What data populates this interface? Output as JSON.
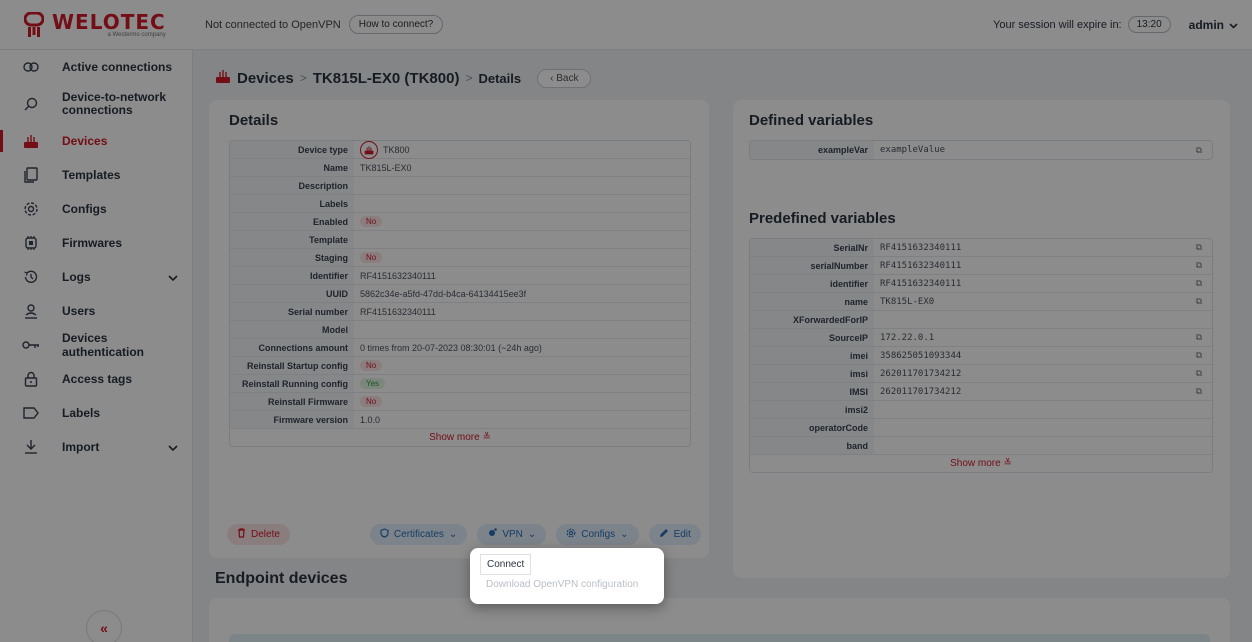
{
  "header": {
    "logo_word": "WELOTEC",
    "logo_sub": "a Westermo company",
    "connection_status": "Not connected to OpenVPN",
    "how_to_connect": "How to connect?",
    "session_label": "Your session will expire in:",
    "session_time": "13:20",
    "user": "admin"
  },
  "sidebar": {
    "items": [
      {
        "label": "Active connections",
        "icon": "link-icon"
      },
      {
        "label": "Device-to-network connections",
        "icon": "search-network-icon"
      },
      {
        "label": "Devices",
        "icon": "router-icon"
      },
      {
        "label": "Templates",
        "icon": "copy-icon"
      },
      {
        "label": "Configs",
        "icon": "gear-icon"
      },
      {
        "label": "Firmwares",
        "icon": "chip-icon"
      },
      {
        "label": "Logs",
        "icon": "history-icon"
      },
      {
        "label": "Users",
        "icon": "user-icon"
      },
      {
        "label": "Devices authentication",
        "icon": "key-icon"
      },
      {
        "label": "Access tags",
        "icon": "lock-icon"
      },
      {
        "label": "Labels",
        "icon": "tag-icon"
      },
      {
        "label": "Import",
        "icon": "import-icon"
      }
    ],
    "collapse_glyph": "«"
  },
  "breadcrumb": {
    "devices": "Devices",
    "device": "TK815L-EX0 (TK800)",
    "details": "Details",
    "back": "Back",
    "sep": ">"
  },
  "details": {
    "title": "Details",
    "rows": [
      {
        "key": "Device type",
        "value": "TK800"
      },
      {
        "key": "Name",
        "value": "TK815L-EX0"
      },
      {
        "key": "Description",
        "value": ""
      },
      {
        "key": "Labels",
        "value": ""
      },
      {
        "key": "Enabled",
        "value": "No"
      },
      {
        "key": "Template",
        "value": ""
      },
      {
        "key": "Staging",
        "value": "No"
      },
      {
        "key": "Identifier",
        "value": "RF4151632340111"
      },
      {
        "key": "UUID",
        "value": "5862c34e-a5fd-47dd-b4ca-64134415ee3f"
      },
      {
        "key": "Serial number",
        "value": "RF4151632340111"
      },
      {
        "key": "Model",
        "value": ""
      },
      {
        "key": "Connections amount",
        "value": "0 times from 20-07-2023 08:30:01 (~24h ago)"
      },
      {
        "key": "Reinstall Startup config",
        "value": "No"
      },
      {
        "key": "Reinstall Running config",
        "value": "Yes"
      },
      {
        "key": "Reinstall Firmware",
        "value": "No"
      },
      {
        "key": "Firmware version",
        "value": "1.0.0"
      }
    ],
    "show_more": "Show more"
  },
  "actions": {
    "delete": "Delete",
    "certificates": "Certificates",
    "vpn": "VPN",
    "configs": "Configs",
    "edit": "Edit"
  },
  "vpn_menu": {
    "connect": "Connect",
    "download": "Download OpenVPN configuration"
  },
  "defined_vars": {
    "title": "Defined variables",
    "rows": [
      {
        "key": "exampleVar",
        "value": "exampleValue"
      }
    ]
  },
  "predefined_vars": {
    "title": "Predefined variables",
    "rows": [
      {
        "key": "SerialNr",
        "value": "RF4151632340111"
      },
      {
        "key": "serialNumber",
        "value": "RF4151632340111"
      },
      {
        "key": "identifier",
        "value": "RF4151632340111"
      },
      {
        "key": "name",
        "value": "TK815L-EX0"
      },
      {
        "key": "XForwardedForIP",
        "value": ""
      },
      {
        "key": "SourceIP",
        "value": "172.22.0.1"
      },
      {
        "key": "imei",
        "value": "358625051093344"
      },
      {
        "key": "imsi",
        "value": "262011701734212"
      },
      {
        "key": "IMSI",
        "value": "262011701734212"
      },
      {
        "key": "imsi2",
        "value": ""
      },
      {
        "key": "operatorCode",
        "value": ""
      },
      {
        "key": "band",
        "value": ""
      }
    ],
    "show_more": "Show more"
  },
  "endpoints": {
    "title": "Endpoint devices"
  }
}
